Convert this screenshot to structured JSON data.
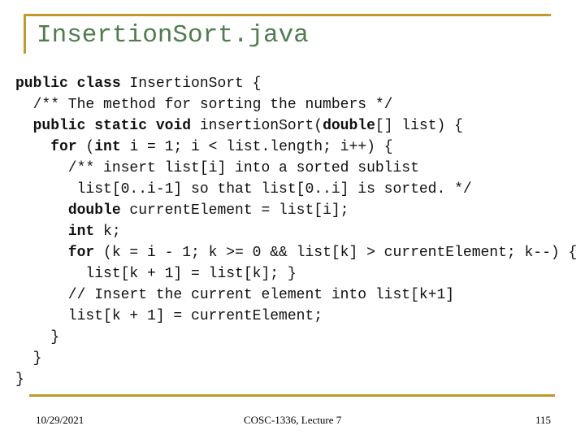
{
  "slide": {
    "title": "InsertionSort.java",
    "accent_color": "#c19a2b",
    "title_color": "#4e7d4e"
  },
  "code": {
    "lines": [
      [
        {
          "t": "public class",
          "b": true
        },
        {
          "t": " InsertionSort {"
        }
      ],
      [
        {
          "t": "  /** The method for sorting the numbers */"
        }
      ],
      [
        {
          "t": "  "
        },
        {
          "t": "public static void",
          "b": true
        },
        {
          "t": " insertionSort("
        },
        {
          "t": "double",
          "b": true
        },
        {
          "t": "[] list) {"
        }
      ],
      [
        {
          "t": "    "
        },
        {
          "t": "for",
          "b": true
        },
        {
          "t": " ("
        },
        {
          "t": "int",
          "b": true
        },
        {
          "t": " i = 1; i < list.length; i++) {"
        }
      ],
      [
        {
          "t": "      /** insert list[i] into a sorted sublist"
        }
      ],
      [
        {
          "t": "       list[0..i-1] so that list[0..i] is sorted. */"
        }
      ],
      [
        {
          "t": "      "
        },
        {
          "t": "double",
          "b": true
        },
        {
          "t": " currentElement = list[i];"
        }
      ],
      [
        {
          "t": "      "
        },
        {
          "t": "int",
          "b": true
        },
        {
          "t": " k;"
        }
      ],
      [
        {
          "t": "      "
        },
        {
          "t": "for",
          "b": true
        },
        {
          "t": " (k = i - 1; k >= 0 && list[k] > currentElement; k--) {"
        }
      ],
      [
        {
          "t": "        list[k + 1] = list[k]; }"
        }
      ],
      [
        {
          "t": "      // Insert the current element into list[k+1]"
        }
      ],
      [
        {
          "t": "      list[k + 1] = currentElement;"
        }
      ],
      [
        {
          "t": "    }"
        }
      ],
      [
        {
          "t": "  }"
        }
      ],
      [
        {
          "t": "}"
        }
      ]
    ]
  },
  "footer": {
    "date": "10/29/2021",
    "course": "COSC-1336, Lecture 7",
    "page_number": "115"
  }
}
